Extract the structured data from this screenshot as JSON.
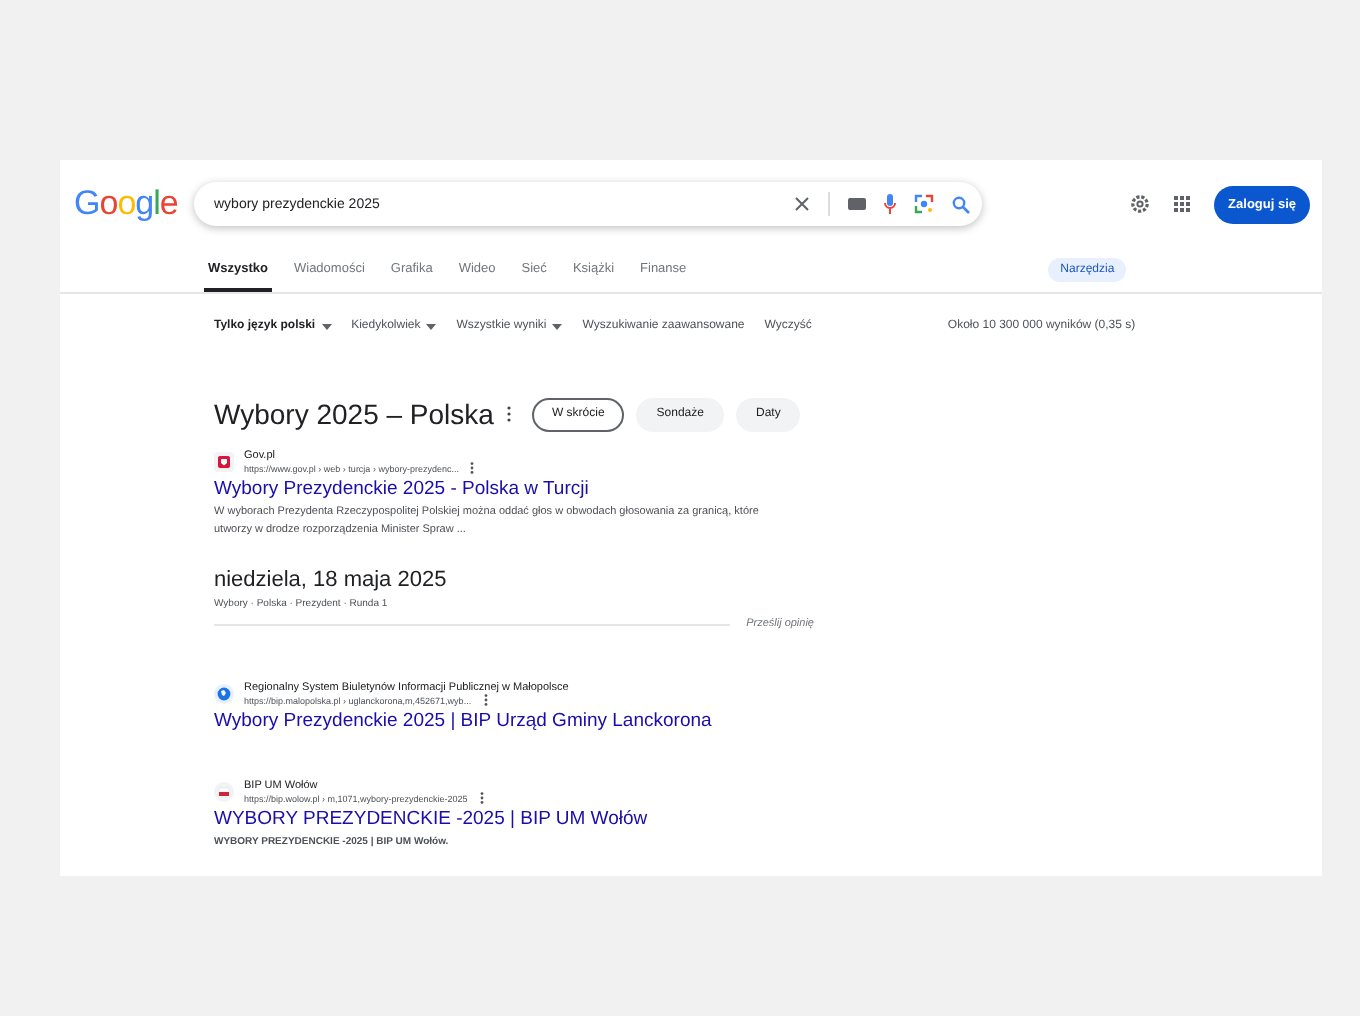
{
  "header": {
    "logo": "Google",
    "search": {
      "value": "wybory prezydenckie 2025"
    },
    "sign_in": "Zaloguj się"
  },
  "tabs": [
    {
      "label": "Wszystko",
      "selected": true
    },
    {
      "label": "Wiadomości",
      "selected": false
    },
    {
      "label": "Grafika",
      "selected": false
    },
    {
      "label": "Wideo",
      "selected": false
    },
    {
      "label": "Sieć",
      "selected": false
    },
    {
      "label": "Książki",
      "selected": false
    },
    {
      "label": "Finanse",
      "selected": false
    }
  ],
  "tools_button": "Narzędzia",
  "filters": [
    {
      "label": "Tylko język polski",
      "kind": "dropdown",
      "bold": true
    },
    {
      "label": "Kiedykolwiek",
      "kind": "dropdown",
      "bold": false
    },
    {
      "label": "Wszystkie wyniki",
      "kind": "dropdown",
      "bold": false
    },
    {
      "label": "Wyszukiwanie zaawansowane",
      "kind": "link",
      "bold": false
    },
    {
      "label": "Wyczyść",
      "kind": "link",
      "bold": false
    }
  ],
  "result_stats": "Około 10 300 000 wyników (0,35 s)",
  "panel": {
    "title": "Wybory 2025 – Polska",
    "chips": [
      {
        "label": "W skrócie",
        "selected": true
      },
      {
        "label": "Sondaże",
        "selected": false
      },
      {
        "label": "Daty",
        "selected": false
      }
    ],
    "top_result": {
      "site": "Gov.pl",
      "url": "https://www.gov.pl › web › turcja › wybory-prezydenc...",
      "title": "Wybory Prezydenckie 2025 - Polska w Turcji",
      "snippet": "W wyborach Prezydenta Rzeczypospolitej Polskiej można oddać głos w obwodach głosowania za granicą, które utworzy w drodze rozporządzenia Minister Spraw ..."
    },
    "date": "niedziela, 18 maja 2025",
    "breadcrumb": "Wybory · Polska · Prezydent · Runda 1",
    "feedback": "Prześlij opinię"
  },
  "results": [
    {
      "kind": "globe",
      "site": "Regionalny System Biuletynów Informacji Publicznej w Małopolsce",
      "url": "https://bip.malopolska.pl › uglanckorona,m,452671,wyb...",
      "title": "Wybory Prezydenckie 2025 | BIP Urząd Gminy Lanckorona"
    },
    {
      "kind": "flag",
      "site": "BIP UM Wołów",
      "url": "https://bip.wolow.pl › m,1071,wybory-prezydenckie-2025",
      "title": "WYBORY PREZYDENCKIE -2025 | BIP UM Wołów",
      "snippet": "WYBORY PREZYDENCKIE -2025 | BIP UM Wołów."
    }
  ]
}
